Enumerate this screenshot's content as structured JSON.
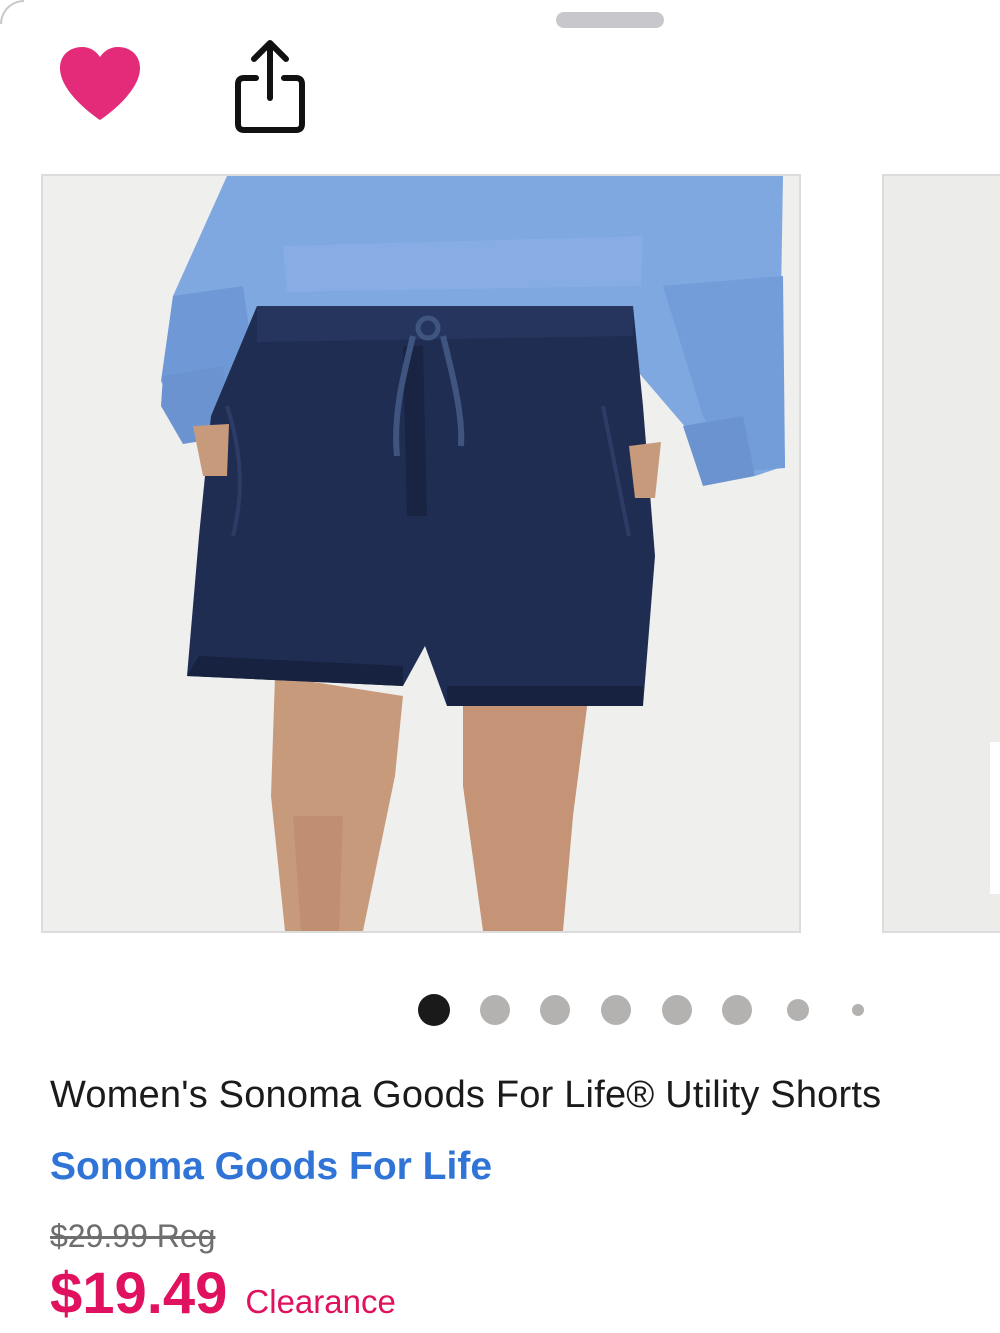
{
  "sheet": {
    "grabber_icon": "drag-handle"
  },
  "actions": {
    "favorite_icon": "heart-filled",
    "favorite_color": "#e32b79",
    "share_icon": "share-arrow-up"
  },
  "gallery": {
    "image_alt": "Model wearing navy utility shorts with drawstring and a blue sweatshirt",
    "total_images": 8,
    "active_index": 0
  },
  "product": {
    "title": "Women's Sonoma Goods For Life® Utility Shorts",
    "brand": "Sonoma Goods For Life",
    "regular_price": "$29.99 Reg",
    "sale_price": "$19.49",
    "sale_label": "Clearance"
  },
  "colors": {
    "brand_link": "#2f74d6",
    "sale": "#e0115f",
    "dot_active": "#1a1a1a",
    "dot_inactive": "#b4b2b0"
  }
}
